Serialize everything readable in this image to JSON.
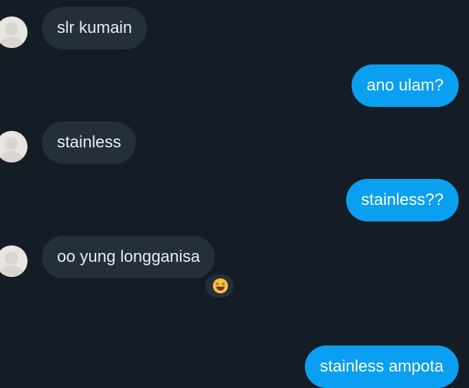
{
  "messages": [
    {
      "direction": "incoming",
      "text": "slr kumain"
    },
    {
      "direction": "outgoing",
      "text": "ano ulam?"
    },
    {
      "direction": "incoming",
      "text": "stainless"
    },
    {
      "direction": "outgoing",
      "text": "stainless??"
    },
    {
      "direction": "incoming",
      "text": "oo yung longganisa",
      "reaction": "grinning-squinting-face-emoji"
    },
    {
      "direction": "outgoing",
      "text": "stainless ampota"
    }
  ],
  "icons": {
    "avatar": "default-user-avatar-icon",
    "reaction": "grinning-squinting-face-emoji"
  },
  "colors": {
    "background": "#141d25",
    "incoming_bubble": "#252f39",
    "outgoing_bubble": "#0a9ff0",
    "incoming_text": "#e8ecef",
    "outgoing_text": "#ffffff"
  }
}
